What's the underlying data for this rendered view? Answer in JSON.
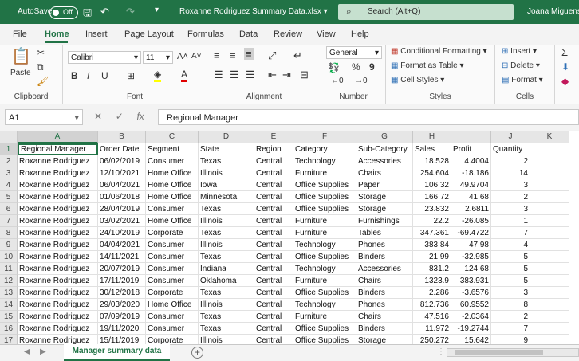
{
  "titlebar": {
    "autosave_label": "AutoSave",
    "autosave_state": "Off",
    "document_title": "Roxanne Rodriguez Summary Data.xlsx",
    "search_placeholder": "Search (Alt+Q)",
    "user_name": "Joana Miguens"
  },
  "ribbon_tabs": [
    "File",
    "Home",
    "Insert",
    "Page Layout",
    "Formulas",
    "Data",
    "Review",
    "View",
    "Help"
  ],
  "ribbon": {
    "clipboard": {
      "label": "Clipboard",
      "paste": "Paste"
    },
    "font": {
      "label": "Font",
      "name": "Calibri",
      "size": "11",
      "grow": "A˄",
      "shrink": "A˅",
      "bold": "B",
      "italic": "I",
      "underline": "U"
    },
    "alignment": {
      "label": "Alignment"
    },
    "number": {
      "label": "Number",
      "format": "General",
      "percent": "%",
      "comma": "9"
    },
    "styles": {
      "label": "Styles",
      "conditional": "Conditional Formatting",
      "format_table": "Format as Table",
      "cell_styles": "Cell Styles"
    },
    "cells": {
      "label": "Cells",
      "insert": "Insert",
      "delete": "Delete",
      "format": "Format"
    }
  },
  "formula_bar": {
    "cell_ref": "A1",
    "content": "Regional Manager"
  },
  "columns": [
    "A",
    "B",
    "C",
    "D",
    "E",
    "F",
    "G",
    "H",
    "I",
    "J",
    "K"
  ],
  "rows": [
    [
      "Regional Manager",
      "Order Date",
      "Segment",
      "State",
      "Region",
      "Category",
      "Sub-Category",
      "Sales",
      "Profit",
      "Quantity",
      ""
    ],
    [
      "Roxanne Rodriguez",
      "06/02/2019",
      "Consumer",
      "Texas",
      "Central",
      "Technology",
      "Accessories",
      "18.528",
      "4.4004",
      "2",
      ""
    ],
    [
      "Roxanne Rodriguez",
      "12/10/2021",
      "Home Office",
      "Illinois",
      "Central",
      "Furniture",
      "Chairs",
      "254.604",
      "-18.186",
      "14",
      ""
    ],
    [
      "Roxanne Rodriguez",
      "06/04/2021",
      "Home Office",
      "Iowa",
      "Central",
      "Office Supplies",
      "Paper",
      "106.32",
      "49.9704",
      "3",
      ""
    ],
    [
      "Roxanne Rodriguez",
      "01/06/2018",
      "Home Office",
      "Minnesota",
      "Central",
      "Office Supplies",
      "Storage",
      "166.72",
      "41.68",
      "2",
      ""
    ],
    [
      "Roxanne Rodriguez",
      "28/04/2019",
      "Consumer",
      "Texas",
      "Central",
      "Office Supplies",
      "Storage",
      "23.832",
      "2.6811",
      "3",
      ""
    ],
    [
      "Roxanne Rodriguez",
      "03/02/2021",
      "Home Office",
      "Illinois",
      "Central",
      "Furniture",
      "Furnishings",
      "22.2",
      "-26.085",
      "1",
      ""
    ],
    [
      "Roxanne Rodriguez",
      "24/10/2019",
      "Corporate",
      "Texas",
      "Central",
      "Furniture",
      "Tables",
      "347.361",
      "-69.4722",
      "7",
      ""
    ],
    [
      "Roxanne Rodriguez",
      "04/04/2021",
      "Consumer",
      "Illinois",
      "Central",
      "Technology",
      "Phones",
      "383.84",
      "47.98",
      "4",
      ""
    ],
    [
      "Roxanne Rodriguez",
      "14/11/2021",
      "Consumer",
      "Texas",
      "Central",
      "Office Supplies",
      "Binders",
      "21.99",
      "-32.985",
      "5",
      ""
    ],
    [
      "Roxanne Rodriguez",
      "20/07/2019",
      "Consumer",
      "Indiana",
      "Central",
      "Technology",
      "Accessories",
      "831.2",
      "124.68",
      "5",
      ""
    ],
    [
      "Roxanne Rodriguez",
      "17/11/2019",
      "Consumer",
      "Oklahoma",
      "Central",
      "Furniture",
      "Chairs",
      "1323.9",
      "383.931",
      "5",
      ""
    ],
    [
      "Roxanne Rodriguez",
      "30/12/2018",
      "Corporate",
      "Texas",
      "Central",
      "Office Supplies",
      "Binders",
      "2.286",
      "-3.6576",
      "3",
      ""
    ],
    [
      "Roxanne Rodriguez",
      "29/03/2020",
      "Home Office",
      "Illinois",
      "Central",
      "Technology",
      "Phones",
      "812.736",
      "60.9552",
      "8",
      ""
    ],
    [
      "Roxanne Rodriguez",
      "07/09/2019",
      "Consumer",
      "Texas",
      "Central",
      "Furniture",
      "Chairs",
      "47.516",
      "-2.0364",
      "2",
      ""
    ],
    [
      "Roxanne Rodriguez",
      "19/11/2020",
      "Consumer",
      "Texas",
      "Central",
      "Office Supplies",
      "Binders",
      "11.972",
      "-19.2744",
      "7",
      ""
    ],
    [
      "Roxanne Rodriguez",
      "15/11/2019",
      "Corporate",
      "Illinois",
      "Central",
      "Office Supplies",
      "Storage",
      "250.272",
      "15.642",
      "9",
      ""
    ]
  ],
  "sheet_tab": "Manager summary data",
  "colors": {
    "accent": "#217346",
    "titlebar": "#217346"
  },
  "icons": [
    "save-icon",
    "undo-icon",
    "redo-icon",
    "search-icon",
    "paste-icon",
    "cut-icon",
    "copy-icon",
    "format-painter-icon"
  ]
}
